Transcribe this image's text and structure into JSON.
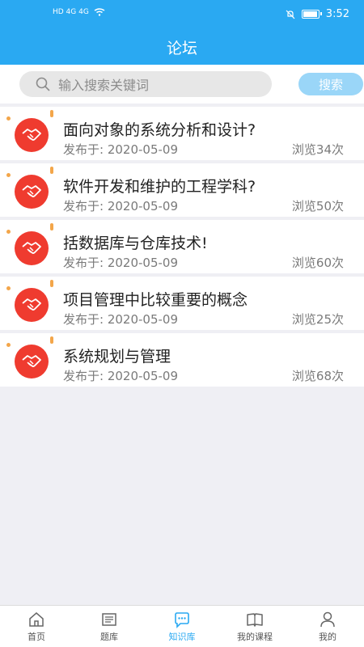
{
  "status_bar": {
    "net_left": "HD 4G 4G",
    "time": "3:52"
  },
  "header": {
    "title": "论坛"
  },
  "search": {
    "placeholder": "输入搜索关键词",
    "button_label": "搜索"
  },
  "posts": [
    {
      "title": "面向对象的系统分析和设计?",
      "date": "发布于:  2020-05-09",
      "views": "浏览34次"
    },
    {
      "title": "软件开发和维护的工程学科?",
      "date": "发布于:  2020-05-09",
      "views": "浏览50次"
    },
    {
      "title": "括数据库与仓库技术!",
      "date": "发布于:  2020-05-09",
      "views": "浏览60次"
    },
    {
      "title": "项目管理中比较重要的概念",
      "date": "发布于:  2020-05-09",
      "views": "浏览25次"
    },
    {
      "title": "系统规划与管理",
      "date": "发布于:  2020-05-09",
      "views": "浏览68次"
    }
  ],
  "tabbar": {
    "items": [
      {
        "label": "首页",
        "icon": "home-icon"
      },
      {
        "label": "题库",
        "icon": "question-bank-icon"
      },
      {
        "label": "知识库",
        "icon": "chat-bubble-icon"
      },
      {
        "label": "我的课程",
        "icon": "book-icon"
      },
      {
        "label": "我的",
        "icon": "user-icon"
      }
    ],
    "active_index": 2
  },
  "colors": {
    "accent": "#2aa9f2",
    "avatar_bg": "#ef3b2f",
    "search_button_bg": "#9ad6f8"
  }
}
